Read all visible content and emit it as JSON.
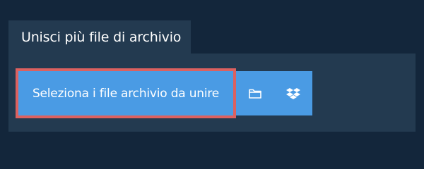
{
  "tab": {
    "label": "Unisci più file di archivio"
  },
  "actions": {
    "select_files_label": "Seleziona i file archivio da unire",
    "folder_icon": "folder-icon",
    "dropbox_icon": "dropbox-icon"
  },
  "colors": {
    "background": "#13263b",
    "panel": "#233a50",
    "button": "#4a9be4",
    "highlight_border": "#dc6160",
    "text": "#ffffff"
  }
}
